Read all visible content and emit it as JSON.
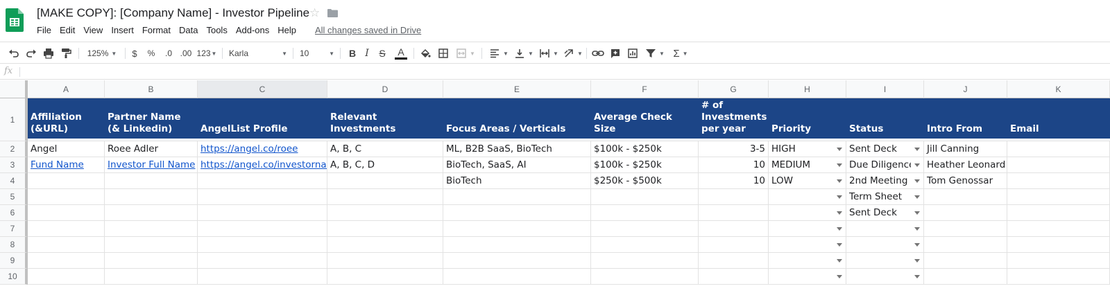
{
  "doc": {
    "title": "[MAKE COPY]: [Company Name] - Investor Pipeline",
    "save_status": "All changes saved in Drive"
  },
  "menu": [
    "File",
    "Edit",
    "View",
    "Insert",
    "Format",
    "Data",
    "Tools",
    "Add-ons",
    "Help"
  ],
  "toolbar": {
    "zoom": "125%",
    "currency": "$",
    "percent": "%",
    "decrease_decimal": ".0",
    "increase_decimal": ".00",
    "number_format": "123",
    "font": "Karla",
    "font_size": "10",
    "bold": "B",
    "italic": "I",
    "strike": "S",
    "text_color": "A",
    "sum": "Σ"
  },
  "formula_bar": {
    "fx": "fx",
    "value": ""
  },
  "colors": {
    "header_band": "#1c4587",
    "link": "#1155cc",
    "sheets_green": "#0f9d58"
  },
  "columns": [
    "A",
    "B",
    "C",
    "D",
    "E",
    "F",
    "G",
    "H",
    "I",
    "J",
    "K"
  ],
  "row_numbers": [
    "1",
    "2",
    "3",
    "4",
    "5",
    "6",
    "7",
    "8",
    "9",
    "10"
  ],
  "header_row": [
    "Affiliation (&URL)",
    "Partner Name (& Linkedin)",
    "AngelList Profile",
    "Relevant Investments",
    "Focus Areas / Verticals",
    "Average Check Size",
    "# of Investments per year",
    "Priority",
    "Status",
    "Intro From",
    "Email"
  ],
  "rows": [
    [
      "Angel",
      "Roee Adler",
      "https://angel.co/roee",
      "A, B, C",
      "ML, B2B SaaS, BioTech",
      "$100k - $250k",
      "3-5",
      "HIGH",
      "Sent Deck",
      "Jill Canning",
      ""
    ],
    [
      "Fund Name",
      "Investor Full Name",
      "https://angel.co/investorname",
      "A, B, C, D",
      "BioTech, SaaS, AI",
      "$100k - $250k",
      "10",
      "MEDIUM",
      "Due Diligence",
      "Heather Leonard",
      ""
    ],
    [
      "",
      "",
      "",
      "",
      "BioTech",
      "$250k - $500k",
      "10",
      "LOW",
      "2nd Meeting",
      "Tom Genossar",
      ""
    ],
    [
      "",
      "",
      "",
      "",
      "",
      "",
      "",
      "",
      "Term Sheet",
      "",
      ""
    ],
    [
      "",
      "",
      "",
      "",
      "",
      "",
      "",
      "",
      "Sent Deck",
      "",
      ""
    ],
    [
      "",
      "",
      "",
      "",
      "",
      "",
      "",
      "",
      "",
      "",
      ""
    ],
    [
      "",
      "",
      "",
      "",
      "",
      "",
      "",
      "",
      "",
      "",
      ""
    ],
    [
      "",
      "",
      "",
      "",
      "",
      "",
      "",
      "",
      "",
      "",
      ""
    ],
    [
      "",
      "",
      "",
      "",
      "",
      "",
      "",
      "",
      "",
      "",
      ""
    ]
  ]
}
